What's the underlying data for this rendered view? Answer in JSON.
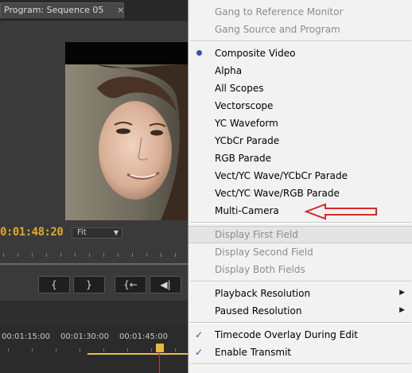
{
  "monitor": {
    "tab_title": "Program: Sequence 05",
    "tab_close": "×",
    "timecode": "0:01:48:20",
    "zoom": "Fit",
    "transport": [
      "{",
      "}",
      "{←",
      "◀|"
    ]
  },
  "timeline": {
    "ticks": [
      "00:01:15:00",
      "00:01:30:00",
      "00:01:45:00"
    ]
  },
  "menu": {
    "gang_reference": "Gang to Reference Monitor",
    "gang_source": "Gang Source and Program",
    "composite_video": "Composite Video",
    "alpha": "Alpha",
    "all_scopes": "All Scopes",
    "vectorscope": "Vectorscope",
    "yc_waveform": "YC Waveform",
    "ycbcr_parade": "YCbCr Parade",
    "rgb_parade": "RGB Parade",
    "vect_yc_ycbcr": "Vect/YC Wave/YCbCr Parade",
    "vect_yc_rgb": "Vect/YC Wave/RGB Parade",
    "multi_camera": "Multi-Camera",
    "display_first_field": "Display First Field",
    "display_second_field": "Display Second Field",
    "display_both_fields": "Display Both Fields",
    "playback_resolution": "Playback Resolution",
    "paused_resolution": "Paused Resolution",
    "timecode_overlay": "Timecode Overlay During Edit",
    "enable_transmit": "Enable Transmit",
    "check_mark": "✓",
    "submenu_arrow": "▶"
  },
  "colors": {
    "timecode": "#e3a82b",
    "menu_bg": "#f2f2f2",
    "annotation_arrow": "#d42a2a"
  }
}
